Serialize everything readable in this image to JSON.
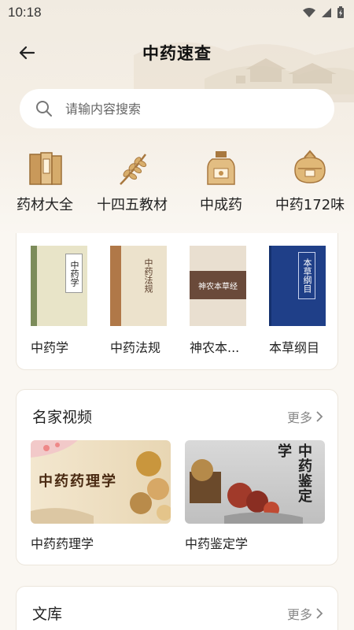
{
  "status": {
    "time": "10:18"
  },
  "header": {
    "title": "中药速查"
  },
  "search": {
    "placeholder": "请输内容搜索"
  },
  "categories": [
    {
      "label": "药材大全",
      "icon": "herb-book-icon"
    },
    {
      "label": "十四五教材",
      "icon": "wheat-sprig-icon"
    },
    {
      "label": "中成药",
      "icon": "medicine-bottle-icon"
    },
    {
      "label": "中药172味",
      "icon": "herb-pouch-icon"
    }
  ],
  "books": [
    {
      "title": "中药学",
      "cover_text": "中药学"
    },
    {
      "title": "中药法规",
      "cover_text": "中药法规"
    },
    {
      "title": "神农本...",
      "cover_text": "神农本草经"
    },
    {
      "title": "本草纲目",
      "cover_text": "本草纲目"
    }
  ],
  "videos_section": {
    "title": "名家视频",
    "more": "更多",
    "items": [
      {
        "title": "中药药理学",
        "thumb_text": "中药药理学"
      },
      {
        "title": "中药鉴定学",
        "thumb_text": "中药鉴定学"
      }
    ]
  },
  "library_section": {
    "title": "文库",
    "more": "更多"
  },
  "colors": {
    "accent": "#5a3d2b",
    "background": "#faf7f2"
  }
}
